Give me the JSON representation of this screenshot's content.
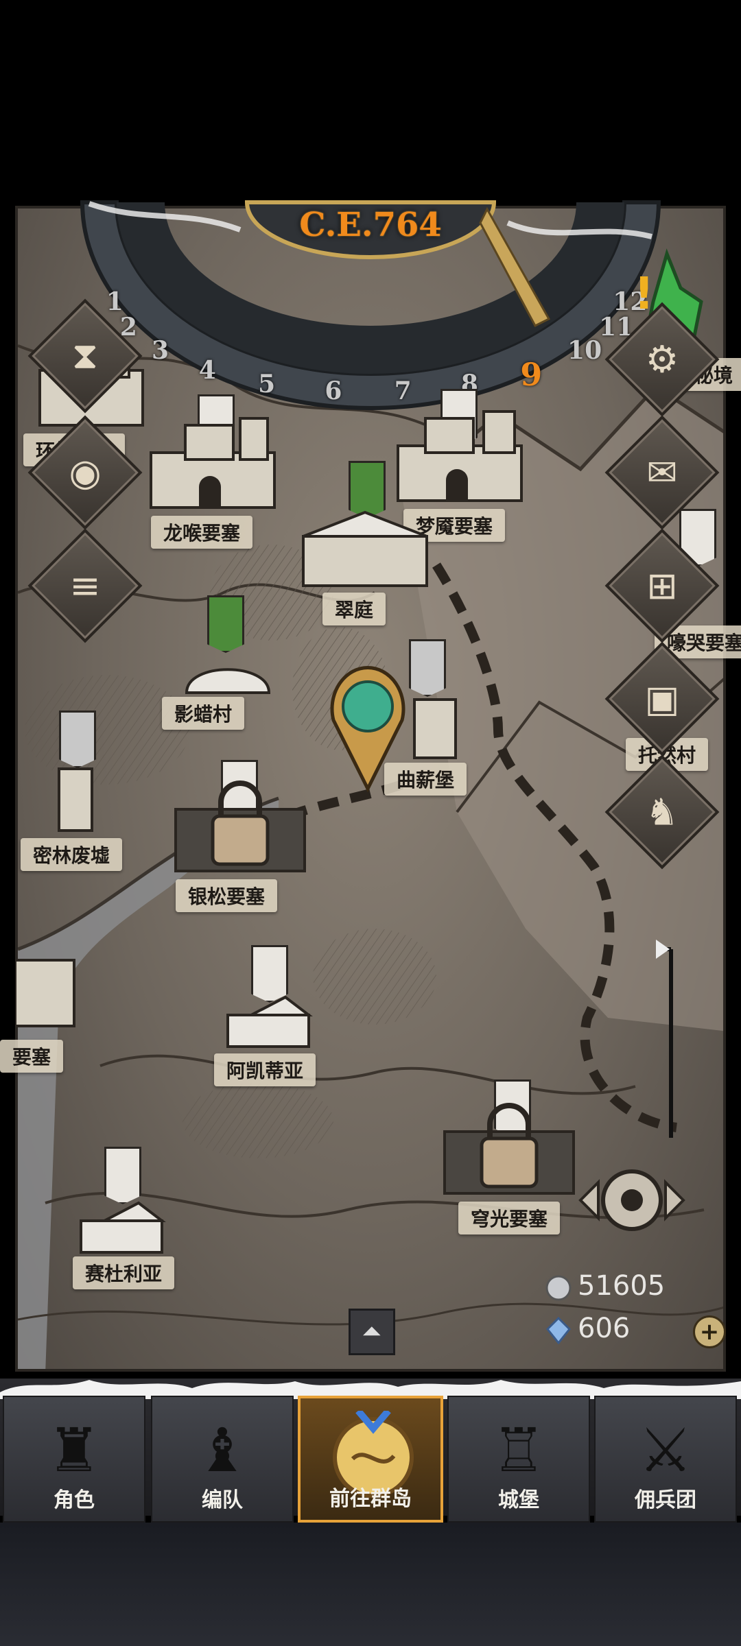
{
  "header": {
    "era": "C.E.764"
  },
  "dial": {
    "months": [
      "1",
      "2",
      "3",
      "4",
      "5",
      "6",
      "7",
      "8",
      "9",
      "10",
      "11",
      "12"
    ],
    "current_month": "9"
  },
  "locations": [
    {
      "key": "huanl",
      "label": "环绕要塞"
    },
    {
      "key": "longhou",
      "label": "龙喉要塞"
    },
    {
      "key": "mengyan",
      "label": "梦魇要塞"
    },
    {
      "key": "cuiting",
      "label": "翠庭"
    },
    {
      "key": "yinglacun",
      "label": "影蜡村"
    },
    {
      "key": "quxinbao",
      "label": "曲薪堡"
    },
    {
      "key": "milin",
      "label": "密林废墟"
    },
    {
      "key": "yinsong",
      "label": "银松要塞"
    },
    {
      "key": "akaidiya",
      "label": "阿凯蒂亚"
    },
    {
      "key": "qiongguang",
      "label": "穹光要塞"
    },
    {
      "key": "saidu",
      "label": "赛杜利亚"
    },
    {
      "key": "haoku",
      "label": "嚎哭要塞"
    },
    {
      "key": "tuoran",
      "label": "托然村"
    },
    {
      "key": "mijing",
      "label": "秘境"
    },
    {
      "key": "left_partial",
      "label": "要塞"
    }
  ],
  "currency": {
    "silver": "51605",
    "crystal": "606"
  },
  "tabs": [
    {
      "label": "角色",
      "icon": "knight-icon"
    },
    {
      "label": "编队",
      "icon": "helmet-icon"
    },
    {
      "label": "前往群岛",
      "icon": "compass-map-icon"
    },
    {
      "label": "城堡",
      "icon": "castle-icon"
    },
    {
      "label": "佣兵团",
      "icon": "mercenary-icon"
    }
  ],
  "colors": {
    "accent": "#e7a239",
    "map": "#7c7369",
    "era_text": "#f08a1c"
  }
}
